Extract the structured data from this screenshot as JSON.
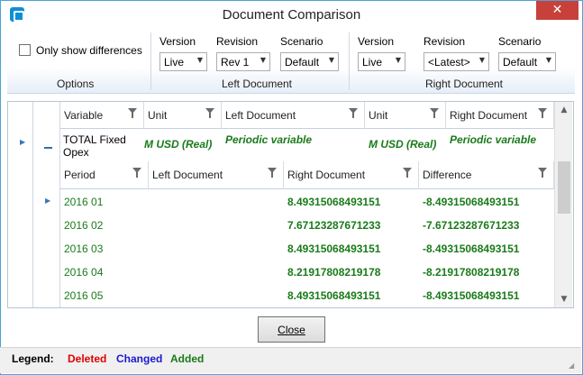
{
  "window": {
    "title": "Document Comparison"
  },
  "options": {
    "only_differences_label": "Only show differences",
    "group_label": "Options"
  },
  "left_document": {
    "group_label": "Left Document",
    "version_label": "Version",
    "version_value": "Live",
    "revision_label": "Revision",
    "revision_value": "Rev 1",
    "scenario_label": "Scenario",
    "scenario_value": "Default"
  },
  "right_document": {
    "group_label": "Right Document",
    "version_label": "Version",
    "version_value": "Live",
    "revision_label": "Revision",
    "revision_value": "<Latest>",
    "scenario_label": "Scenario",
    "scenario_value": "Default"
  },
  "grid": {
    "headers": [
      "Variable",
      "Unit",
      "Left Document",
      "Unit",
      "Right Document"
    ],
    "variable_row": {
      "variable": "TOTAL Fixed Opex",
      "left_unit": "M USD (Real)",
      "left_document": "Periodic variable",
      "right_unit": "M USD (Real)",
      "right_document": "Periodic variable"
    },
    "sub_headers": [
      "Period",
      "Left Document",
      "Right Document",
      "Difference"
    ],
    "rows": [
      {
        "period": "2016 01",
        "left": "",
        "right": "8.49315068493151",
        "difference": "-8.49315068493151"
      },
      {
        "period": "2016 02",
        "left": "",
        "right": "7.67123287671233",
        "difference": "-7.67123287671233"
      },
      {
        "period": "2016 03",
        "left": "",
        "right": "8.49315068493151",
        "difference": "-8.49315068493151"
      },
      {
        "period": "2016 04",
        "left": "",
        "right": "8.21917808219178",
        "difference": "-8.21917808219178"
      },
      {
        "period": "2016 05",
        "left": "",
        "right": "8.49315068493151",
        "difference": "-8.49315068493151"
      }
    ]
  },
  "close_button_label": "Close",
  "legend": {
    "label": "Legend:",
    "deleted": "Deleted",
    "changed": "Changed",
    "added": "Added",
    "colors": {
      "deleted": "#e00000",
      "changed": "#1a1ad0",
      "added": "#1a7a1a"
    }
  }
}
